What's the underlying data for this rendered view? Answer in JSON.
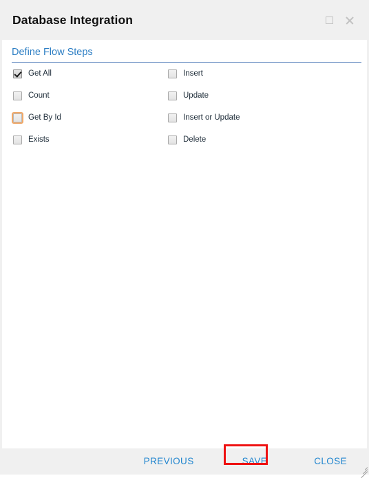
{
  "dialog": {
    "title": "Database Integration",
    "window_controls": [
      {
        "name": "maximize",
        "label": ""
      },
      {
        "name": "close",
        "label": ""
      }
    ]
  },
  "section": {
    "header": "Define Flow Steps"
  },
  "flow_steps": {
    "rows": [
      {
        "left": {
          "label": "Get All",
          "checked": true,
          "focused": false
        },
        "right": {
          "label": "Insert",
          "checked": false,
          "focused": false
        }
      },
      {
        "left": {
          "label": "Count",
          "checked": false,
          "focused": false
        },
        "right": {
          "label": "Update",
          "checked": false,
          "focused": false
        }
      },
      {
        "left": {
          "label": "Get By Id",
          "checked": false,
          "focused": true
        },
        "right": {
          "label": "Insert or Update",
          "checked": false,
          "focused": false
        }
      },
      {
        "left": {
          "label": "Exists",
          "checked": false,
          "focused": false
        },
        "right": {
          "label": "Delete",
          "checked": false,
          "focused": false
        }
      }
    ]
  },
  "footer": {
    "previous_label": "PREVIOUS",
    "save_label": "SAVE",
    "close_label": "CLOSE"
  },
  "colors": {
    "accent_blue": "#2286cf",
    "section_blue": "#2e7fc4",
    "highlight_red": "#ee1111",
    "focus_orange": "#f0a868",
    "chrome_gray": "#f0f0f0"
  }
}
